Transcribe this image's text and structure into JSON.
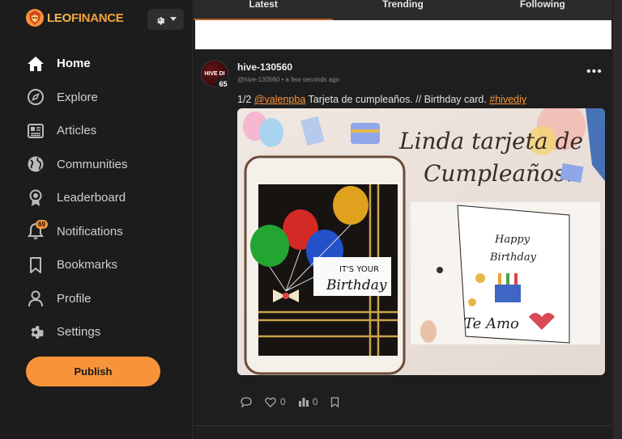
{
  "app": {
    "logo_text": "LEOFINANCE",
    "logo_leo": "LEO",
    "logo_finance": "FINANCE"
  },
  "sidebar": {
    "settings_icon": "gear-icon",
    "items": [
      {
        "label": "Home",
        "icon": "home-icon",
        "active": true
      },
      {
        "label": "Explore",
        "icon": "compass-icon"
      },
      {
        "label": "Articles",
        "icon": "newspaper-icon"
      },
      {
        "label": "Communities",
        "icon": "globe-icon"
      },
      {
        "label": "Leaderboard",
        "icon": "award-icon"
      },
      {
        "label": "Notifications",
        "icon": "bell-icon",
        "badge": "69"
      },
      {
        "label": "Bookmarks",
        "icon": "bookmark-icon"
      },
      {
        "label": "Profile",
        "icon": "user-icon"
      },
      {
        "label": "Settings",
        "icon": "gear-icon"
      }
    ],
    "publish_label": "Publish"
  },
  "feed": {
    "tabs": [
      "Latest",
      "Trending",
      "Following"
    ],
    "active_tab": "Latest"
  },
  "post": {
    "author": "hive-130560",
    "author_handle": "@hive-130560",
    "time": "a few seconds ago",
    "reputation": "65",
    "avatar_text": "HIVE DI",
    "text_prefix": "1/2 ",
    "mention": "@valenpba",
    "text_middle": " Tarjeta de cumpleaños. // Birthday card. ",
    "hashtag": "#hivediy",
    "image_title_line1": "Linda tarjeta de",
    "image_title_line2": "Cumpleaños.",
    "card_text_1": "IT'S YOUR",
    "card_text_2": "Birthday",
    "card_text_3": "Happy",
    "card_text_4": "Birthday",
    "card_text_5": "Te Amo",
    "likes": "0",
    "views": "0"
  },
  "colors": {
    "accent": "#f7943a",
    "background": "#1e1e1f",
    "sidebar": "#1c1c1d"
  }
}
